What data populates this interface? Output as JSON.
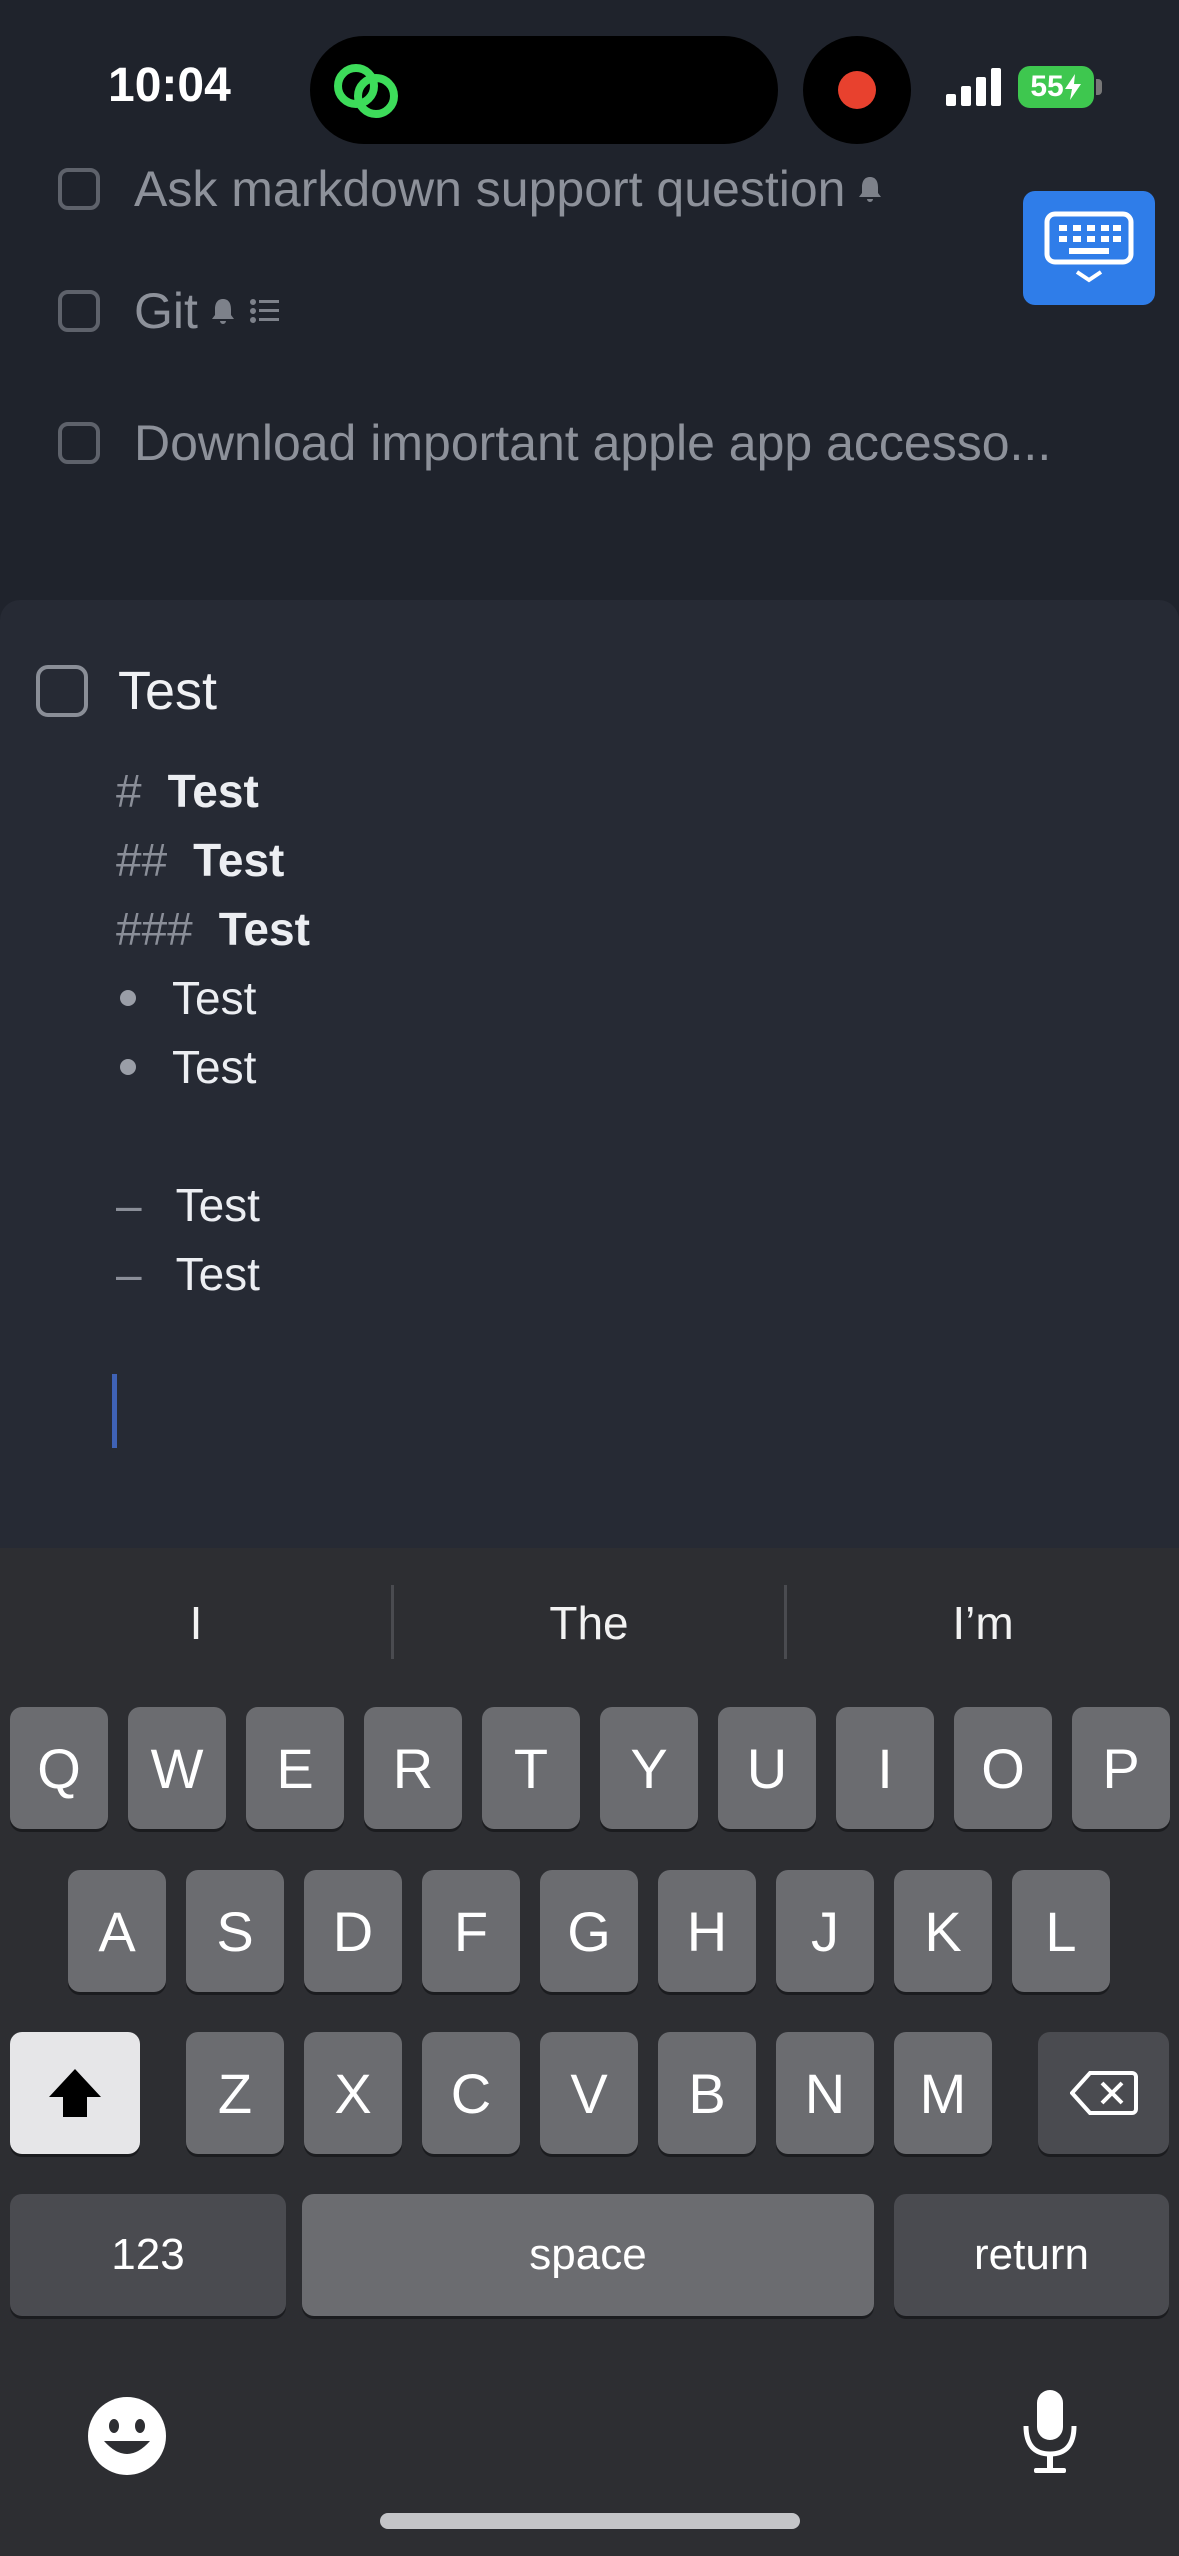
{
  "status_bar": {
    "time": "10:04",
    "battery": "55"
  },
  "background_list": {
    "items": [
      {
        "label": "Ask markdown support question"
      },
      {
        "label": "Git"
      },
      {
        "label": "Download important apple app accesso..."
      }
    ]
  },
  "task": {
    "title": "Test",
    "note_lines": [
      {
        "kind": "h1",
        "marker": "#",
        "text": "Test"
      },
      {
        "kind": "h2",
        "marker": "##",
        "text": "Test"
      },
      {
        "kind": "h3",
        "marker": "###",
        "text": "Test"
      },
      {
        "kind": "bullet",
        "text": "Test"
      },
      {
        "kind": "bullet",
        "text": "Test"
      },
      {
        "kind": "dash",
        "marker": "–",
        "text": "Test"
      },
      {
        "kind": "dash",
        "marker": "–",
        "text": "Test"
      }
    ]
  },
  "keyboard": {
    "suggestions": [
      "I",
      "The",
      "I’m"
    ],
    "row1": [
      "Q",
      "W",
      "E",
      "R",
      "T",
      "Y",
      "U",
      "I",
      "O",
      "P"
    ],
    "row2": [
      "A",
      "S",
      "D",
      "F",
      "G",
      "H",
      "J",
      "K",
      "L"
    ],
    "row3": [
      "Z",
      "X",
      "C",
      "V",
      "B",
      "N",
      "M"
    ],
    "numbers_label": "123",
    "space_label": "space",
    "return_label": "return"
  },
  "colors": {
    "accent": "#2f7de9",
    "record": "#e8412e",
    "battery": "#3ec74f"
  }
}
